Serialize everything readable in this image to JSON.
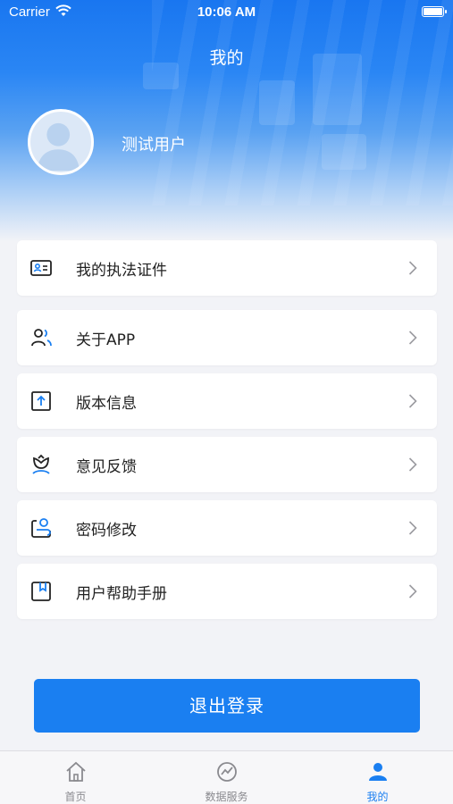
{
  "status_bar": {
    "carrier": "Carrier",
    "time": "10:06 AM"
  },
  "page": {
    "title": "我的"
  },
  "profile": {
    "username": "测试用户"
  },
  "menu": {
    "items": [
      {
        "label": "我的执法证件",
        "icon": "id-card-icon"
      },
      {
        "label": "关于APP",
        "icon": "users-icon"
      },
      {
        "label": "版本信息",
        "icon": "upload-icon"
      },
      {
        "label": "意见反馈",
        "icon": "flower-icon"
      },
      {
        "label": "密码修改",
        "icon": "password-icon"
      },
      {
        "label": "用户帮助手册",
        "icon": "bookmark-book-icon"
      }
    ]
  },
  "logout": {
    "label": "退出登录"
  },
  "tabbar": {
    "tabs": [
      {
        "label": "首页",
        "icon": "home-icon",
        "active": false
      },
      {
        "label": "数据服务",
        "icon": "data-service-icon",
        "active": false
      },
      {
        "label": "我的",
        "icon": "user-icon",
        "active": true
      }
    ]
  },
  "colors": {
    "accent": "#1a7ff1",
    "background": "#f2f3f7",
    "inactive_tab": "#8a8a8f"
  }
}
